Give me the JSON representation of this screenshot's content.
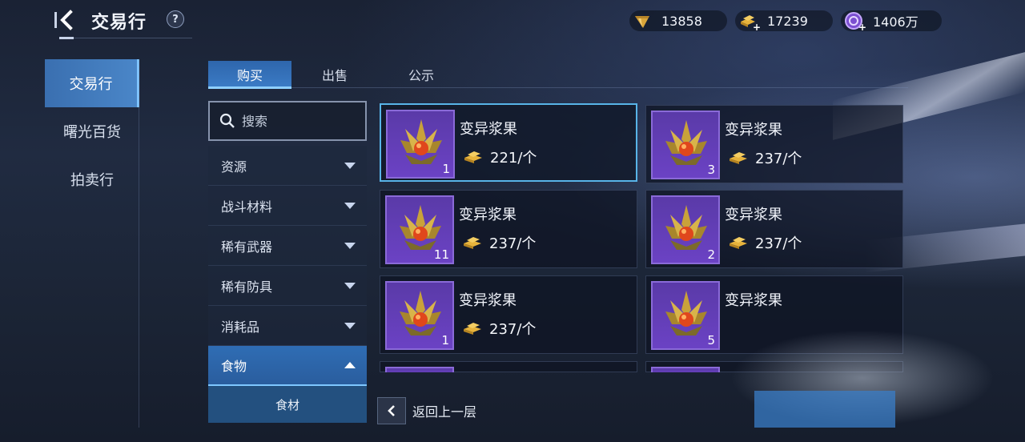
{
  "header": {
    "title": "交易行",
    "help_label": "?"
  },
  "currencies": [
    {
      "name": "diamond",
      "value": "13858"
    },
    {
      "name": "gold-bar",
      "value": "17239"
    },
    {
      "name": "crystal",
      "value": "1406万"
    }
  ],
  "left_nav": {
    "items": [
      {
        "label": "交易行",
        "active": true
      },
      {
        "label": "曙光百货",
        "active": false
      },
      {
        "label": "拍卖行",
        "active": false
      }
    ]
  },
  "tabs": [
    {
      "label": "购买",
      "active": true
    },
    {
      "label": "出售",
      "active": false
    },
    {
      "label": "公示",
      "active": false
    }
  ],
  "search": {
    "placeholder": "搜索"
  },
  "categories": [
    {
      "label": "资源",
      "expanded": false
    },
    {
      "label": "战斗材料",
      "expanded": false
    },
    {
      "label": "稀有武器",
      "expanded": false
    },
    {
      "label": "稀有防具",
      "expanded": false
    },
    {
      "label": "消耗品",
      "expanded": false
    },
    {
      "label": "食物",
      "expanded": true
    }
  ],
  "sub_category": {
    "label": "食材"
  },
  "items": [
    {
      "name": "变异浆果",
      "price": "221/个",
      "quantity": "1",
      "selected": true
    },
    {
      "name": "变异浆果",
      "price": "237/个",
      "quantity": "3",
      "selected": false
    },
    {
      "name": "变异浆果",
      "price": "237/个",
      "quantity": "11",
      "selected": false
    },
    {
      "name": "变异浆果",
      "price": "237/个",
      "quantity": "2",
      "selected": false
    },
    {
      "name": "变异浆果",
      "price": "237/个",
      "quantity": "1",
      "selected": false
    },
    {
      "name": "变异浆果",
      "price": "",
      "quantity": "5",
      "selected": false
    }
  ],
  "footer": {
    "back_label": "返回上一层"
  },
  "colors": {
    "accent": "#3b7bc5",
    "selected_border": "#58b4e8",
    "item_bg": "#6b42c4",
    "gold": "#e7b33c"
  }
}
